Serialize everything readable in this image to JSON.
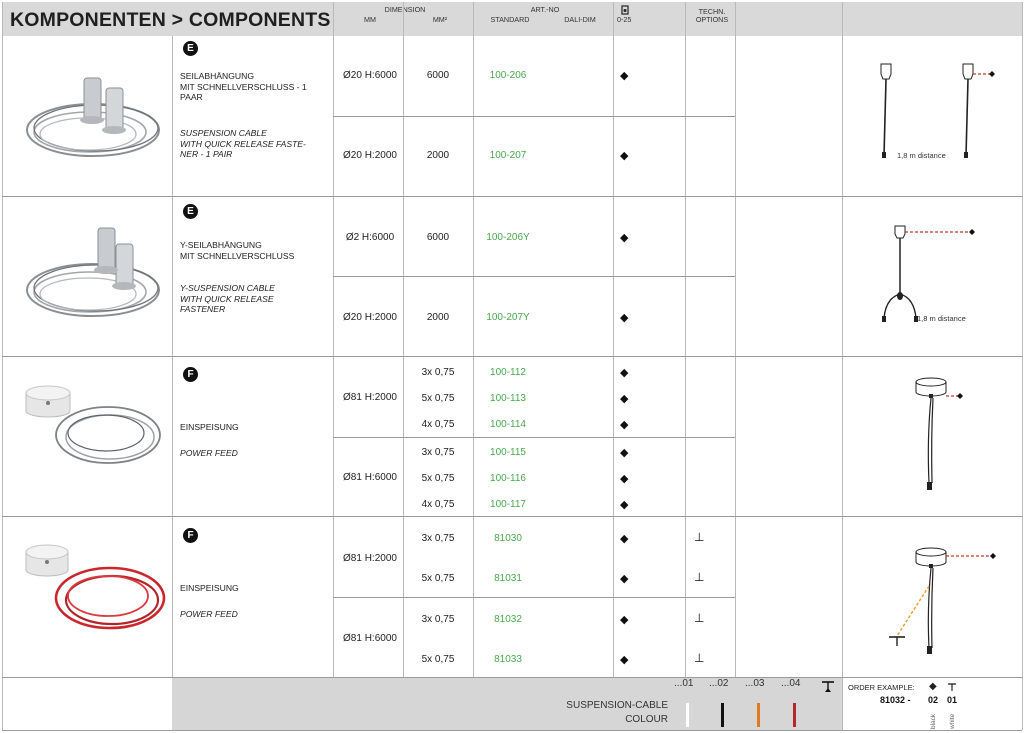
{
  "header": {
    "title": "KOMPONENTEN > COMPONENTS",
    "dimension": "DIMENSION",
    "mm": "MM",
    "mm2": "MM²",
    "art_no": "ART.-NO",
    "standard": "STANDARD",
    "dali_dim": "DALI-DIM",
    "range": "0-25",
    "techn": "TECHN.",
    "options": "OPTIONS"
  },
  "groups": [
    {
      "letter": "E",
      "name_de": [
        "SEILABHÄNGUNG",
        "MIT SCHNELLVERSCHLUSS - 1",
        "PAAR"
      ],
      "name_en": [
        "SUSPENSION CABLE",
        "WITH QUICK RELEASE FASTE-",
        "NER - 1 PAIR"
      ],
      "rows": [
        {
          "dimension": "Ø20 H:6000",
          "mm2": "6000",
          "standard": "100-206",
          "dim_symbol": "◆",
          "option": ""
        },
        {
          "dimension": "Ø20 H:2000",
          "mm2": "2000",
          "standard": "100-207",
          "dim_symbol": "◆",
          "option": ""
        }
      ],
      "distance_label": "1,8 m distance"
    },
    {
      "letter": "E",
      "name_de": [
        "Y-SEILABHÄNGUNG",
        "MIT SCHNELLVERSCHLUSS"
      ],
      "name_en": [
        "Y-SUSPENSION CABLE",
        "WITH QUICK RELEASE",
        "FASTENER"
      ],
      "rows": [
        {
          "dimension": "Ø2 H:6000",
          "mm2": "6000",
          "standard": "100-206Y",
          "dim_symbol": "◆",
          "option": ""
        },
        {
          "dimension": "Ø20 H:2000",
          "mm2": "2000",
          "standard": "100-207Y",
          "dim_symbol": "◆",
          "option": ""
        }
      ],
      "distance_label": "1,8 m distance"
    },
    {
      "letter": "F",
      "name_de": [
        "EINSPEISUNG"
      ],
      "name_en": [
        "POWER FEED"
      ],
      "blocks": [
        {
          "dimension": "Ø81 H:2000",
          "rows": [
            {
              "mm2": "3x 0,75",
              "standard": "100-112",
              "dim_symbol": "◆"
            },
            {
              "mm2": "5x 0,75",
              "standard": "100-113",
              "dim_symbol": "◆"
            },
            {
              "mm2": "4x 0,75",
              "standard": "100-114",
              "dim_symbol": "◆"
            }
          ]
        },
        {
          "dimension": "Ø81 H:6000",
          "rows": [
            {
              "mm2": "3x 0,75",
              "standard": "100-115",
              "dim_symbol": "◆"
            },
            {
              "mm2": "5x 0,75",
              "standard": "100-116",
              "dim_symbol": "◆"
            },
            {
              "mm2": "4x 0,75",
              "standard": "100-117",
              "dim_symbol": "◆"
            }
          ]
        }
      ]
    },
    {
      "letter": "F",
      "name_de": [
        "EINSPEISUNG"
      ],
      "name_en": [
        "POWER FEED"
      ],
      "blocks": [
        {
          "dimension": "Ø81 H:2000",
          "rows": [
            {
              "mm2": "3x 0,75",
              "standard": "81030",
              "dim_symbol": "◆",
              "option": "⊥"
            },
            {
              "mm2": "5x 0,75",
              "standard": "81031",
              "dim_symbol": "◆",
              "option": "⊥"
            }
          ]
        },
        {
          "dimension": "Ø81 H:6000",
          "rows": [
            {
              "mm2": "3x 0,75",
              "standard": "81032",
              "dim_symbol": "◆",
              "option": "⊥"
            },
            {
              "mm2": "5x 0,75",
              "standard": "81033",
              "dim_symbol": "◆",
              "option": "⊥"
            }
          ]
        }
      ]
    }
  ],
  "footer": {
    "label_line1": "SUSPENSION-CABLE",
    "label_line2": "COLOUR",
    "colours": [
      {
        "code": "...01",
        "color": "#ffffff"
      },
      {
        "code": "...02",
        "color": "#111111"
      },
      {
        "code": "...03",
        "color": "#e07a22"
      },
      {
        "code": "...04",
        "color": "#b3272d"
      }
    ],
    "order_example_label": "ORDER EXAMPLE:",
    "order_code": "81032 -",
    "order_part1": "02",
    "order_part2": "01",
    "vert_black": "black",
    "vert_white": "white"
  },
  "colors": {
    "article_green": "#48a84d",
    "header_gray": "#d9d9d9",
    "footer_gray": "#d6d6d6",
    "dashed_red": "#c0392b"
  }
}
